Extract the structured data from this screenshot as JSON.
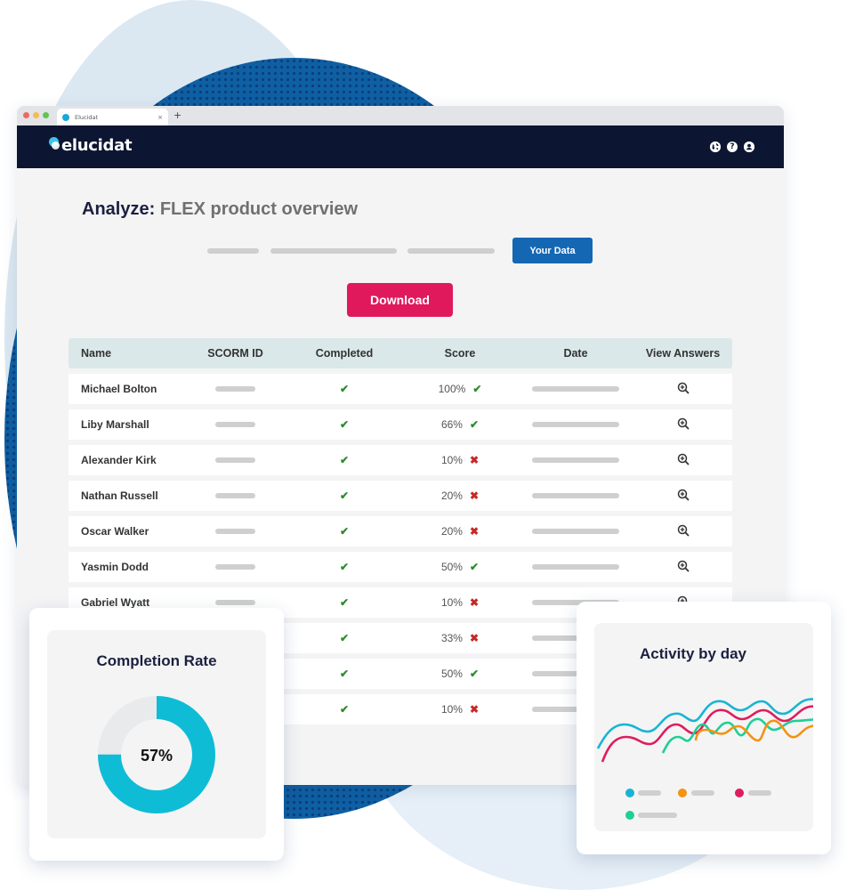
{
  "browser": {
    "tab_title": "Elucidat",
    "tab_close": "×",
    "new_tab": "+"
  },
  "appbar": {
    "logo_text": "elucidat",
    "icons": [
      "globe-icon",
      "help-icon",
      "user-icon"
    ],
    "help_glyph": "?"
  },
  "page": {
    "title_prefix": "Analyze:",
    "title_main": "FLEX product overview",
    "your_data_label": "Your Data",
    "download_label": "Download"
  },
  "colors": {
    "navy": "#0c1632",
    "primary_blue": "#1467b3",
    "download_pink": "#e0195d",
    "success_green": "#2e8b2e",
    "fail_red": "#c62828",
    "donut_cyan": "#0fbcd6"
  },
  "table": {
    "headers": [
      "Name",
      "SCORM ID",
      "Completed",
      "Score",
      "Date",
      "View Answers"
    ],
    "rows": [
      {
        "name": "Michael Bolton",
        "completed": "✔",
        "score": "100%",
        "pass": true
      },
      {
        "name": "Liby Marshall",
        "completed": "✔",
        "score": "66%",
        "pass": true
      },
      {
        "name": "Alexander Kirk",
        "completed": "✔",
        "score": "10%",
        "pass": false
      },
      {
        "name": "Nathan Russell",
        "completed": "✔",
        "score": "20%",
        "pass": false
      },
      {
        "name": "Oscar Walker",
        "completed": "✔",
        "score": "20%",
        "pass": false
      },
      {
        "name": "Yasmin Dodd",
        "completed": "✔",
        "score": "50%",
        "pass": true
      },
      {
        "name": "Gabriel Wyatt",
        "completed": "✔",
        "score": "10%",
        "pass": false
      },
      {
        "name": "",
        "completed": "✔",
        "score": "33%",
        "pass": false
      },
      {
        "name": "",
        "completed": "✔",
        "score": "50%",
        "pass": true
      },
      {
        "name": "",
        "completed": "✔",
        "score": "10%",
        "pass": false
      }
    ]
  },
  "completion_card": {
    "title": "Completion Rate",
    "label": "57%",
    "value_fraction_shown": 0.75
  },
  "activity_card": {
    "title": "Activity by day",
    "series_colors": [
      "#18b4d4",
      "#f39314",
      "#de1d5f",
      "#1ecf96"
    ]
  }
}
